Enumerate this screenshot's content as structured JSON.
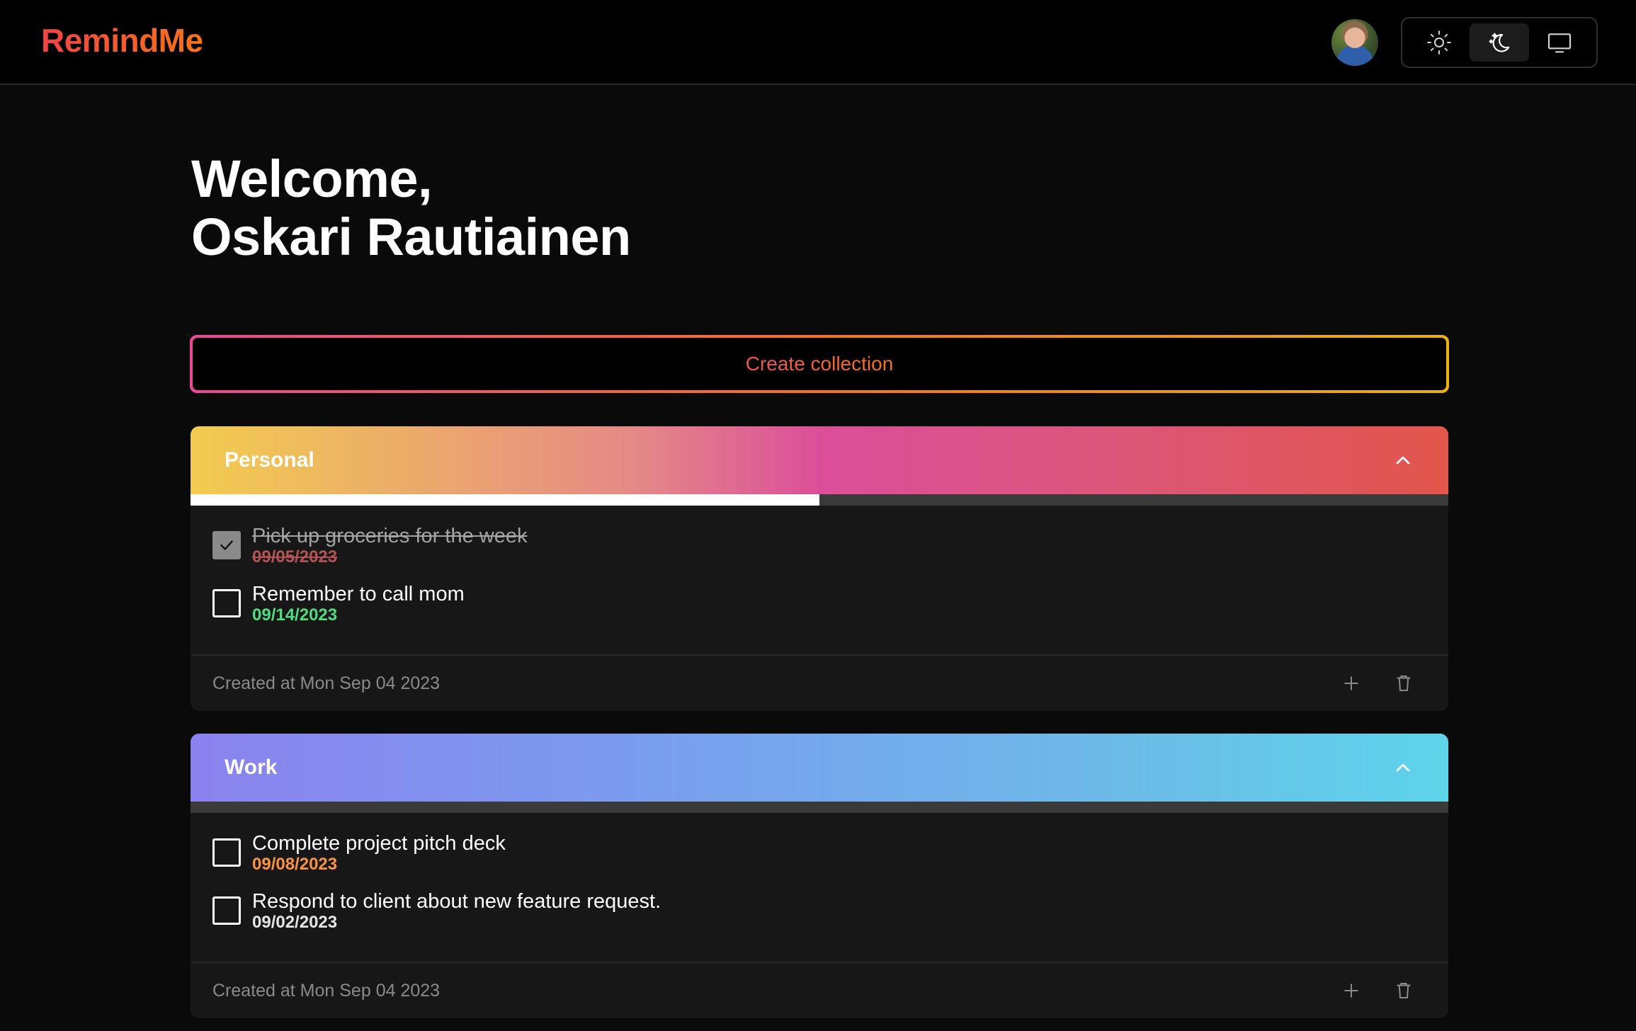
{
  "app": {
    "name": "RemindMe"
  },
  "header": {
    "avatar_alt": "user-avatar",
    "theme": {
      "options": [
        "light",
        "dark",
        "system"
      ],
      "selected": "dark"
    }
  },
  "welcome": {
    "line1": "Welcome,",
    "line2": "Oskari Rautiainen"
  },
  "create_collection": {
    "label": "Create collection"
  },
  "collections": [
    {
      "name": "Personal",
      "progress_fraction": 0.5,
      "tasks": [
        {
          "title": "Pick up groceries for the week",
          "date": "09/05/2023",
          "done": true
        },
        {
          "title": "Remember to call mom",
          "date": "09/14/2023",
          "done": false,
          "date_color": "#4ade80"
        }
      ],
      "created": "Created at Mon Sep 04 2023"
    },
    {
      "name": "Work",
      "progress_fraction": 0,
      "tasks": [
        {
          "title": "Complete project pitch deck",
          "date": "09/08/2023",
          "done": false,
          "date_color": "#fb923c"
        },
        {
          "title": "Respond to client about new feature request.",
          "date": "09/02/2023",
          "done": false,
          "date_color": "#e5e5e5"
        }
      ],
      "created": "Created at Mon Sep 04 2023"
    }
  ],
  "colors": {
    "brand_gradient": [
      "#ef4444",
      "#f97316"
    ],
    "background": "#0a0a0a",
    "card": "#171717"
  }
}
